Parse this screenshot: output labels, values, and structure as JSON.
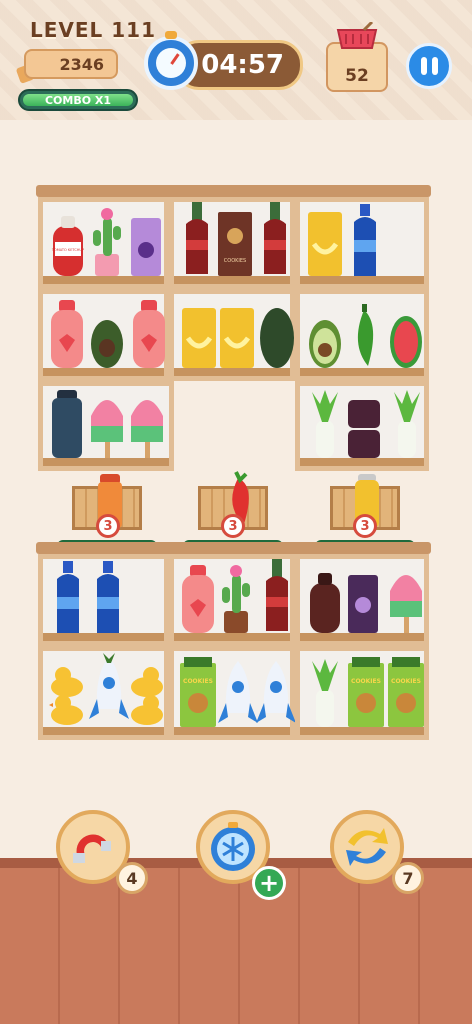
{
  "hud": {
    "level_label": "LEVEL 111",
    "score": "2346",
    "combo_label": "COMBO X1",
    "combo_progress": 1.0,
    "timer": "04:57",
    "basket_count": "52"
  },
  "crates": [
    {
      "remaining": "3",
      "item": "orange-bottle"
    },
    {
      "remaining": "3",
      "item": "chili-pepper"
    },
    {
      "remaining": "3",
      "item": "yellow-can"
    }
  ],
  "shelf_labels": {
    "ketchup": "TOMATO KETCHUP",
    "cookies": "COOKIES"
  },
  "boosters": {
    "magnet_count": "4",
    "freeze_add": "+",
    "shuffle_count": "7"
  },
  "colors": {
    "accent_blue": "#2b8be6",
    "timer_bg": "#8b5a36",
    "combo_green": "#3bb35a",
    "badge_red": "#d64b3e"
  }
}
